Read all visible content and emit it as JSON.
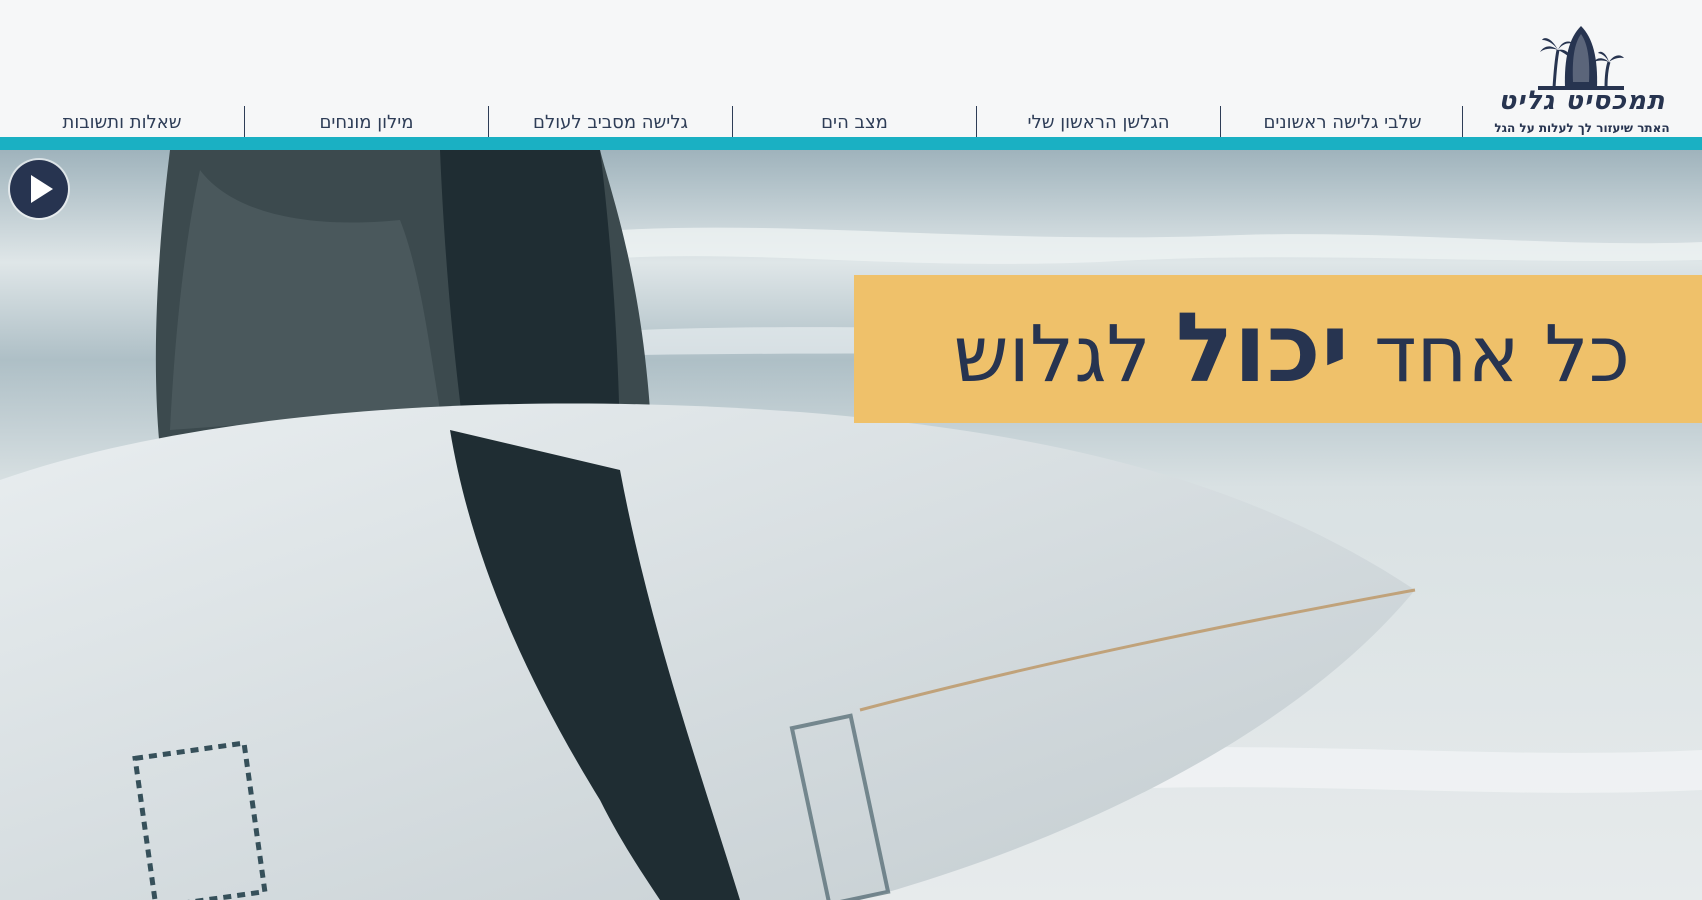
{
  "logo": {
    "title": "תמכסיט גליט",
    "tagline": "האתר שיעזור לך לעלות על הגל",
    "icon": "surfboard-palm-logo"
  },
  "nav": {
    "items": [
      {
        "label": "שאלות ותשובות"
      },
      {
        "label": "מילון מונחים"
      },
      {
        "label": "גלישה מסביב לעולם"
      },
      {
        "label": "מצב הים"
      },
      {
        "label": "הגלשן הראשון שלי"
      },
      {
        "label": "שלבי גלישה ראשונים"
      }
    ]
  },
  "hero": {
    "headline_before": "כל אחד",
    "headline_emphasis": "יכול",
    "headline_after": "לגלוש",
    "play_icon": "play-icon"
  },
  "colors": {
    "accent": "#1ab0c3",
    "navy": "#273450",
    "banner": "#efc16a",
    "header_bg": "#f6f7f8"
  }
}
